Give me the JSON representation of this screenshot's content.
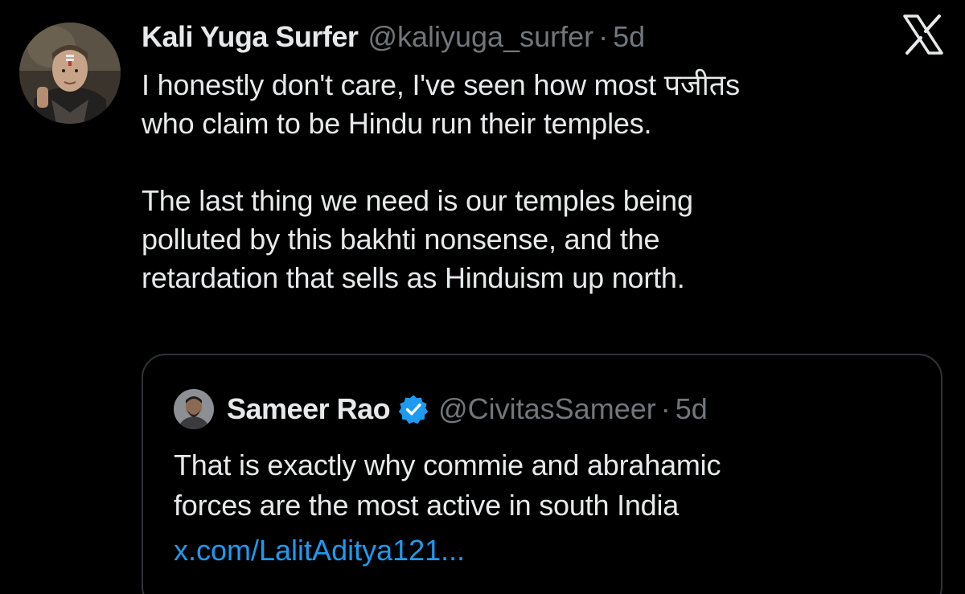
{
  "tweet": {
    "author": {
      "display_name": "Kali Yuga Surfer",
      "handle": "@kaliyuga_surfer",
      "separator": "·",
      "time": "5d",
      "avatar_icon": "profile-photo-avatar"
    },
    "text_lines": [
      "I honestly don't care, I've seen how most पजीतs",
      "who claim to be Hindu run their temples.",
      "The last thing we need is our temples being",
      "polluted by this bakhti nonsense, and the",
      "retardation that sells as Hinduism up north."
    ]
  },
  "quote": {
    "author": {
      "display_name": "Sameer Rao",
      "verified_icon": "verified-badge-icon",
      "handle": "@CivitasSameer",
      "separator": "·",
      "time": "5d",
      "avatar_icon": "profile-photo-avatar"
    },
    "text_lines": [
      "That is exactly why commie and abrahamic",
      "forces are the most active in south India"
    ],
    "link": "x.com/LalitAditya121..."
  },
  "branding": {
    "logo_icon": "x-logo-icon"
  },
  "colors": {
    "background": "#000000",
    "primary_text": "#e7e9ea",
    "secondary_text": "#71767b",
    "link": "#1d9bf0",
    "verified": "#1d9bf0",
    "border": "#2f3336"
  }
}
